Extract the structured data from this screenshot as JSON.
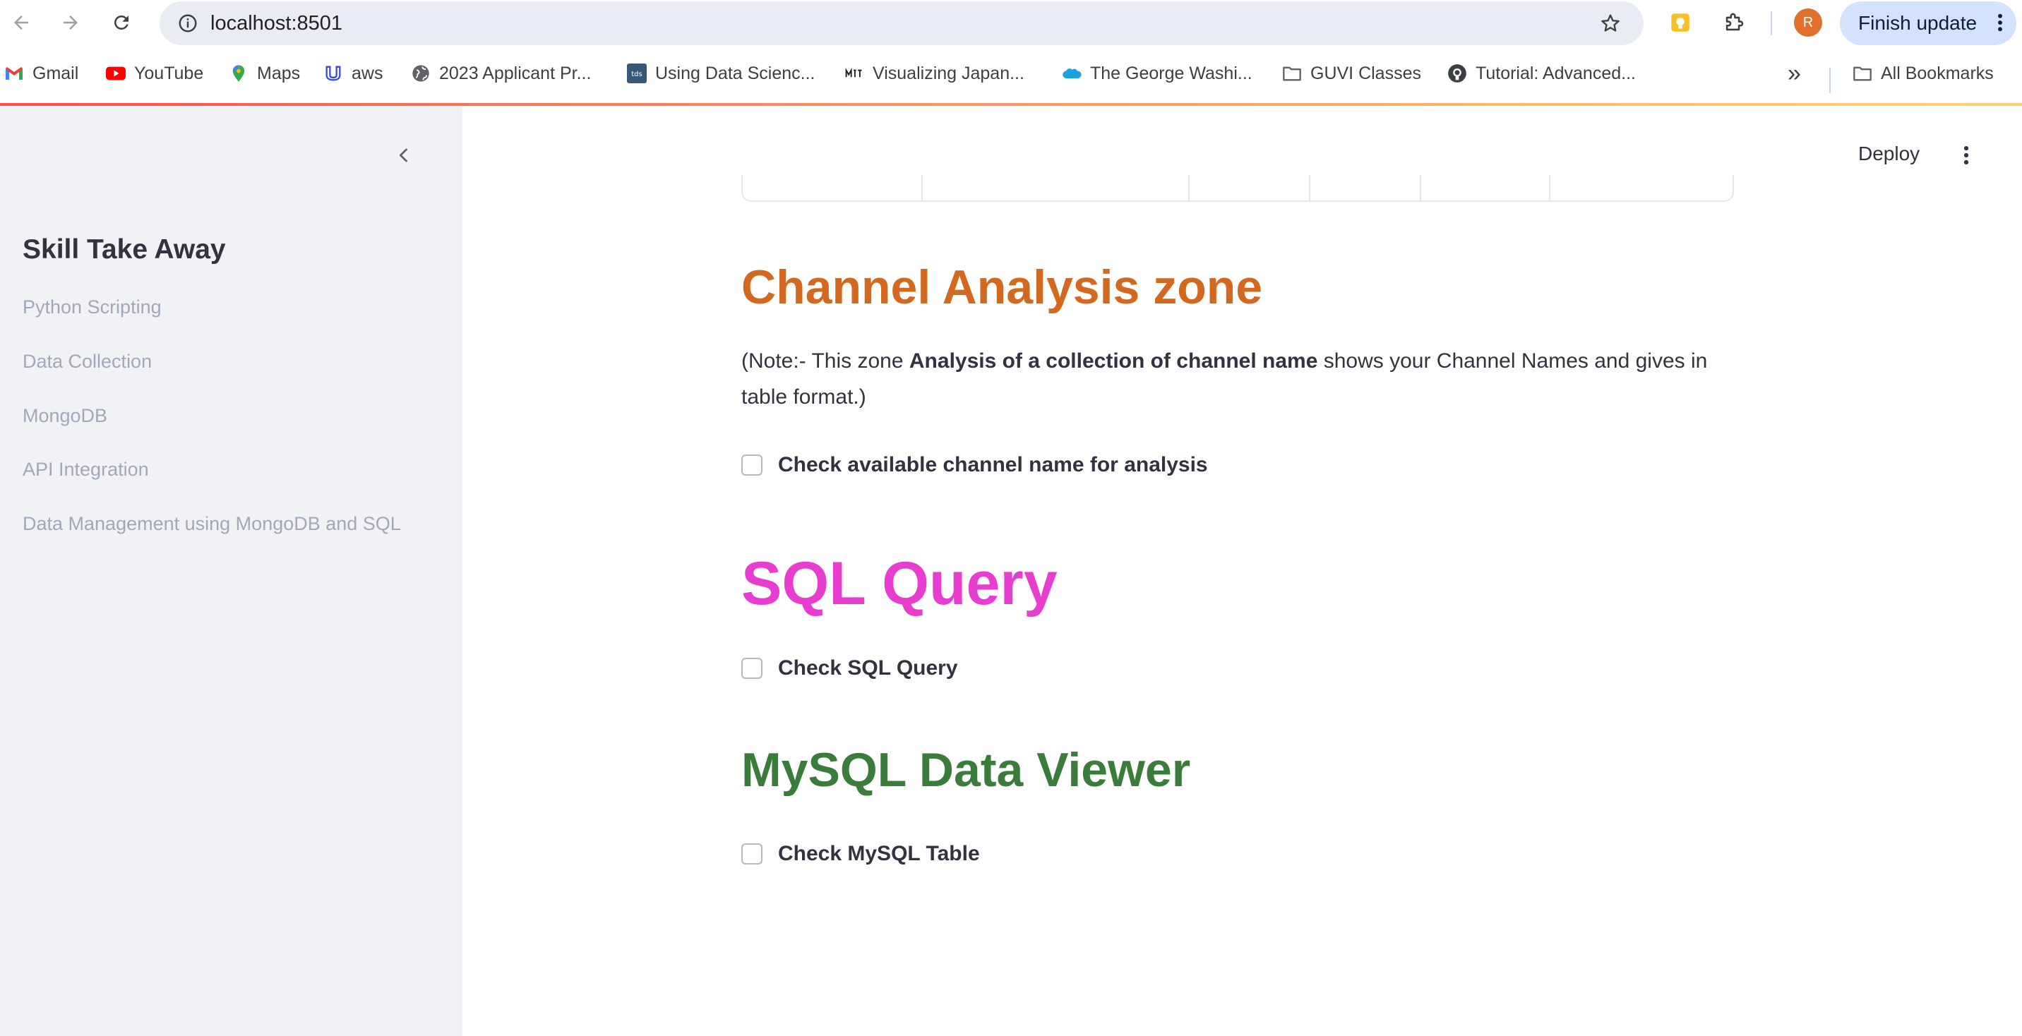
{
  "browser": {
    "url": "localhost:8501",
    "finish_update": "Finish update",
    "avatar_letter": "R",
    "bookmarks": [
      {
        "label": "Gmail",
        "icon": "gmail-icon"
      },
      {
        "label": "YouTube",
        "icon": "youtube-icon"
      },
      {
        "label": "Maps",
        "icon": "maps-icon"
      },
      {
        "label": "aws",
        "icon": "udacity-icon"
      },
      {
        "label": "2023 Applicant Pr...",
        "icon": "globe-icon"
      },
      {
        "label": "Using Data Scienc...",
        "icon": "tds-icon"
      },
      {
        "label": "Visualizing Japan...",
        "icon": "mit-icon"
      },
      {
        "label": "The George Washi...",
        "icon": "salesforce-cloud-icon"
      },
      {
        "label": "GUVI Classes",
        "icon": "folder-icon"
      },
      {
        "label": "Tutorial: Advanced...",
        "icon": "github-icon"
      }
    ],
    "more_bookmarks": "»",
    "all_bookmarks": "All Bookmarks"
  },
  "sidebar": {
    "title": "Skill Take Away",
    "items": [
      {
        "label": "Python Scripting"
      },
      {
        "label": "Data Collection"
      },
      {
        "label": "MongoDB"
      },
      {
        "label": "API Integration"
      },
      {
        "label": "Data Management using MongoDB and SQL"
      }
    ]
  },
  "header": {
    "deploy_label": "Deploy"
  },
  "main": {
    "channel_section": {
      "heading": "Channel Analysis zone",
      "heading_color": "#d2691e",
      "note_prefix": "(Note:- This zone ",
      "note_bold": "Analysis of a collection of channel name",
      "note_suffix": " shows your Channel Names and gives in table format.)",
      "checkbox_label": "Check available channel name for analysis"
    },
    "sql_section": {
      "heading": "SQL Query",
      "heading_color": "#e83ecf",
      "checkbox_label": "Check SQL Query"
    },
    "mysql_section": {
      "heading": "MySQL Data Viewer",
      "heading_color": "#3a7d3a",
      "checkbox_label": "Check MySQL Table"
    }
  }
}
